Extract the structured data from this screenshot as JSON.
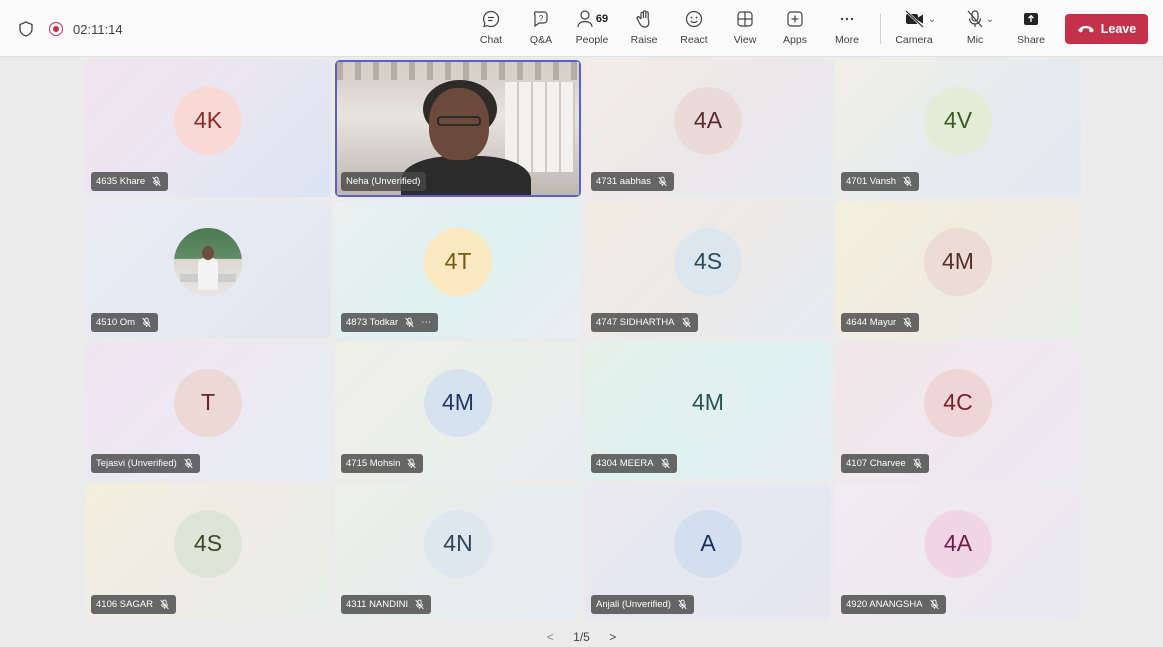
{
  "meeting": {
    "timer": "02:11:14"
  },
  "toolbar": {
    "chat": "Chat",
    "qa": "Q&A",
    "people": "People",
    "people_count": "69",
    "raise": "Raise",
    "react": "React",
    "view": "View",
    "apps": "Apps",
    "more": "More",
    "camera": "Camera",
    "mic": "Mic",
    "share": "Share",
    "leave": "Leave"
  },
  "participants": [
    {
      "name": "4635 Khare",
      "initials": "4K",
      "bg": "linear-gradient(135deg,#f1e4ee 0%,#e9e6f2 50%,#dbe3f1 100%)",
      "avatar_bg": "#f9d9d6",
      "avatar_fg": "#8b2d2a"
    },
    {
      "name": "Neha (Unverified)",
      "initials": "",
      "video": true
    },
    {
      "name": "4731 aabhas",
      "initials": "4A",
      "bg": "linear-gradient(135deg,#f2ede6 0%,#ece8ea 50%,#e6e9ef 100%)",
      "avatar_bg": "#eadbd8",
      "avatar_fg": "#5b2b2b"
    },
    {
      "name": "4701 Vansh",
      "initials": "4V",
      "bg": "linear-gradient(135deg,#f1f0e6 0%,#e7ebed 50%,#e3e8f3 100%)",
      "avatar_bg": "#e2ecd6",
      "avatar_fg": "#3b5b23"
    },
    {
      "name": "4510 Om",
      "initials": "",
      "photo": true,
      "bg": "linear-gradient(135deg,#ecebf3 0%,#e6e9f3 50%,#e5e4f1 100%)"
    },
    {
      "name": "4873 Todkar",
      "initials": "4T",
      "more": true,
      "bg": "linear-gradient(135deg,#eaf1ef 0%,#dff0ef 50%,#e9eef3 100%)",
      "avatar_bg": "#fbe8c1",
      "avatar_fg": "#7a5a12"
    },
    {
      "name": "4747 SIDHARTHA",
      "initials": "4S",
      "bg": "linear-gradient(135deg,#f1ece1 0%,#eceae8 50%,#e6ebf1 100%)",
      "avatar_bg": "#dbe6ee",
      "avatar_fg": "#2e4b5e"
    },
    {
      "name": "4644 Mayur",
      "initials": "4M",
      "bg": "linear-gradient(135deg,#f3f0dd 0%,#efece1 50%,#e9ece9 100%)",
      "avatar_bg": "#ecdcd6",
      "avatar_fg": "#5a2f2a"
    },
    {
      "name": "Tejasvi (Unverified)",
      "initials": "T",
      "bg": "linear-gradient(135deg,#efe4f1 0%,#ece9f2 50%,#e7ecf1 100%)",
      "avatar_bg": "#ecd8d5",
      "avatar_fg": "#6a2722"
    },
    {
      "name": "4715 Mohsin",
      "initials": "4M",
      "bg": "linear-gradient(135deg,#eef0e6 0%,#eceeea 50%,#e9edf1 100%)",
      "avatar_bg": "#d7e2f1",
      "avatar_fg": "#1f3864"
    },
    {
      "name": "4304 MEERA",
      "initials": "4M",
      "bg": "linear-gradient(135deg,#e5f1ea 0%,#dff0ef 50%,#e6eef2 100%)",
      "avatar_bg": "#e3f0f0",
      "avatar_fg": "#2a5556"
    },
    {
      "name": "4107 Charvee",
      "initials": "4C",
      "bg": "linear-gradient(135deg,#f1e6e8 0%,#efe8ee 50%,#ebe9f1 100%)",
      "avatar_bg": "#f0d5d7",
      "avatar_fg": "#7a1f2b"
    },
    {
      "name": "4106 SAGAR",
      "initials": "4S",
      "bg": "linear-gradient(135deg,#f2eedf 0%,#eeece4 50%,#e9ecec 100%)",
      "avatar_bg": "#dfe4d9",
      "avatar_fg": "#3b4a2a"
    },
    {
      "name": "4311 NANDINI",
      "initials": "4N",
      "bg": "linear-gradient(135deg,#edf0ea 0%,#e7ecec 50%,#e7ecf1 100%)",
      "avatar_bg": "#dee7ef",
      "avatar_fg": "#2d4559"
    },
    {
      "name": "Anjali (Unverified)",
      "initials": "A",
      "bg": "linear-gradient(135deg,#ebe8f1 0%,#e5e7f1 50%,#e7e6ef 100%)",
      "avatar_bg": "#d3def0",
      "avatar_fg": "#1b2f5b"
    },
    {
      "name": "4920 ANANGSHA",
      "initials": "4A",
      "bg": "linear-gradient(135deg,#f1ecf1 0%,#ede9ef 50%,#e8e9ef 100%)",
      "avatar_bg": "#f0d6e4",
      "avatar_fg": "#6a1e4a"
    }
  ],
  "pager": {
    "label": "1/5",
    "prev": "<",
    "next": ">"
  }
}
